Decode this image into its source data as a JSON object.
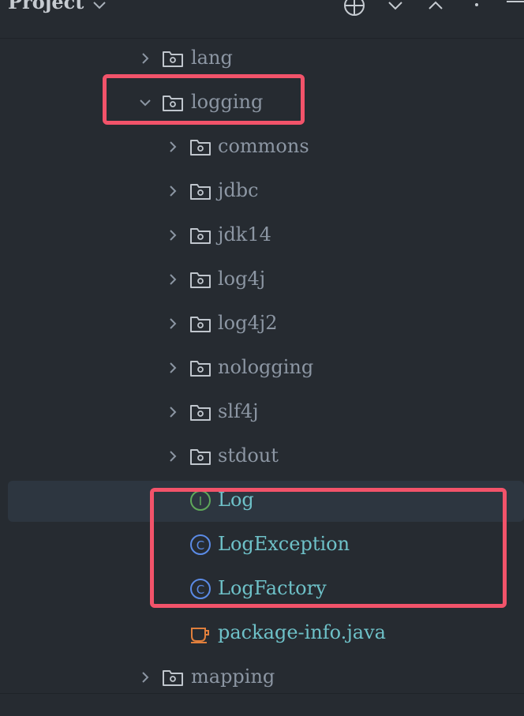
{
  "header": {
    "title": "Project",
    "actions": [
      "locate-icon",
      "expand-all-icon",
      "collapse-all-icon",
      "more-icon",
      "hide-icon"
    ]
  },
  "tree": {
    "items": [
      {
        "label": "lang",
        "kind": "package",
        "expanded": false
      },
      {
        "label": "logging",
        "kind": "package",
        "expanded": true
      },
      {
        "label": "commons",
        "kind": "package",
        "expanded": false
      },
      {
        "label": "jdbc",
        "kind": "package",
        "expanded": false
      },
      {
        "label": "jdk14",
        "kind": "package",
        "expanded": false
      },
      {
        "label": "log4j",
        "kind": "package",
        "expanded": false
      },
      {
        "label": "log4j2",
        "kind": "package",
        "expanded": false
      },
      {
        "label": "nologging",
        "kind": "package",
        "expanded": false
      },
      {
        "label": "slf4j",
        "kind": "package",
        "expanded": false
      },
      {
        "label": "stdout",
        "kind": "package",
        "expanded": false
      },
      {
        "label": "Log",
        "kind": "interface",
        "badge": "I",
        "selected": true
      },
      {
        "label": "LogException",
        "kind": "class",
        "badge": "C"
      },
      {
        "label": "LogFactory",
        "kind": "class",
        "badge": "C"
      },
      {
        "label": "package-info.java",
        "kind": "java-file"
      },
      {
        "label": "mapping",
        "kind": "package",
        "expanded": false
      }
    ]
  },
  "colors": {
    "background": "#262b31",
    "text": "#8c96a3",
    "code_text": "#6ec1c8",
    "highlight": "#f2536a",
    "interface_badge": "#5fa85a",
    "class_badge": "#5b8be6",
    "java_file": "#e07f3c"
  }
}
